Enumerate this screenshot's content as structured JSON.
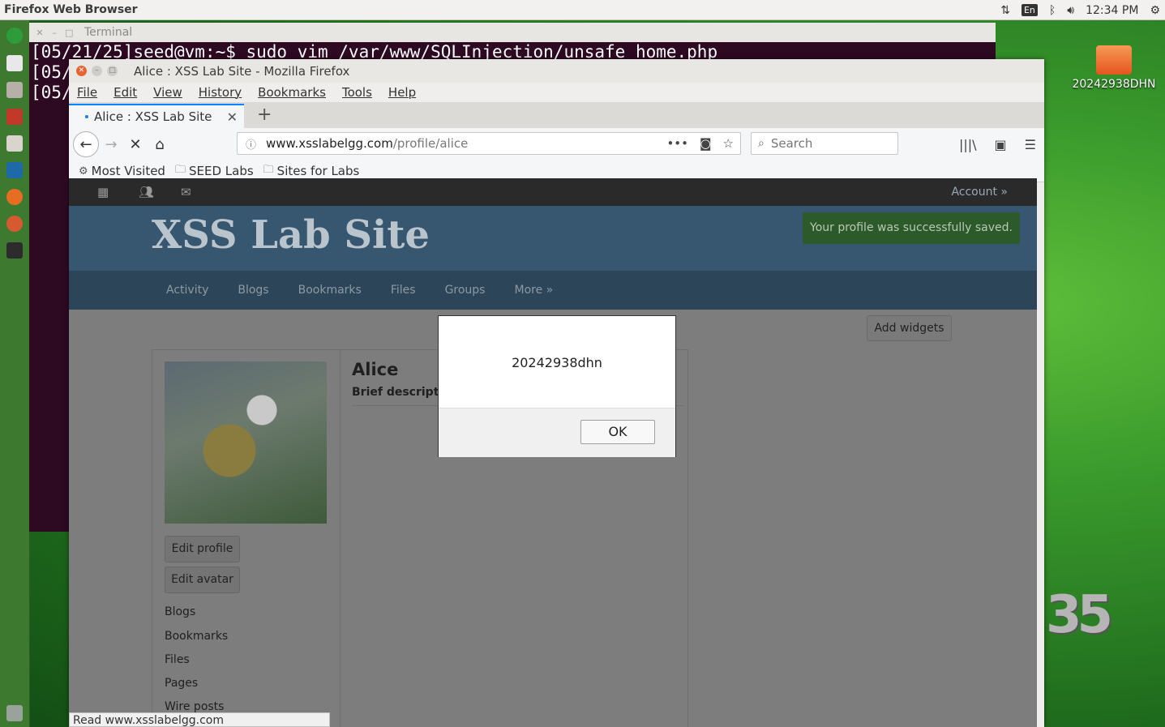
{
  "topbar": {
    "app_title": "Firefox Web Browser",
    "lang": "En",
    "clock": "12:34 PM"
  },
  "terminal": {
    "title": "Terminal",
    "lines": [
      "[05/21/25]seed@vm:~$ sudo vim /var/www/SQLInjection/unsafe_home.php",
      "[05/",
      "[05/"
    ]
  },
  "desktop": {
    "folder_label": "20242938DHN",
    "logo": "35"
  },
  "firefox": {
    "window_title": "Alice : XSS Lab Site - Mozilla Firefox",
    "menu": [
      "File",
      "Edit",
      "View",
      "History",
      "Bookmarks",
      "Tools",
      "Help"
    ],
    "tab_label": "Alice : XSS Lab Site",
    "url_host": "www.xsslabelgg.com",
    "url_path": "/profile/alice",
    "search_placeholder": "Search",
    "bookmarks": [
      "Most Visited",
      "SEED Labs",
      "Sites for Labs"
    ],
    "status_text": "Read www.xsslabelgg.com"
  },
  "site": {
    "account": "Account »",
    "brand": "XSS Lab Site",
    "message": "Your profile was successfully saved.",
    "nav": [
      "Activity",
      "Blogs",
      "Bookmarks",
      "Files",
      "Groups",
      "More »"
    ],
    "add_widgets": "Add widgets",
    "profile_name": "Alice",
    "brief_description": "Brief descriptio",
    "edit_profile": "Edit profile",
    "edit_avatar": "Edit avatar",
    "links": [
      "Blogs",
      "Bookmarks",
      "Files",
      "Pages",
      "Wire posts"
    ]
  },
  "alert": {
    "message": "20242938dhn",
    "ok_label": "OK"
  }
}
